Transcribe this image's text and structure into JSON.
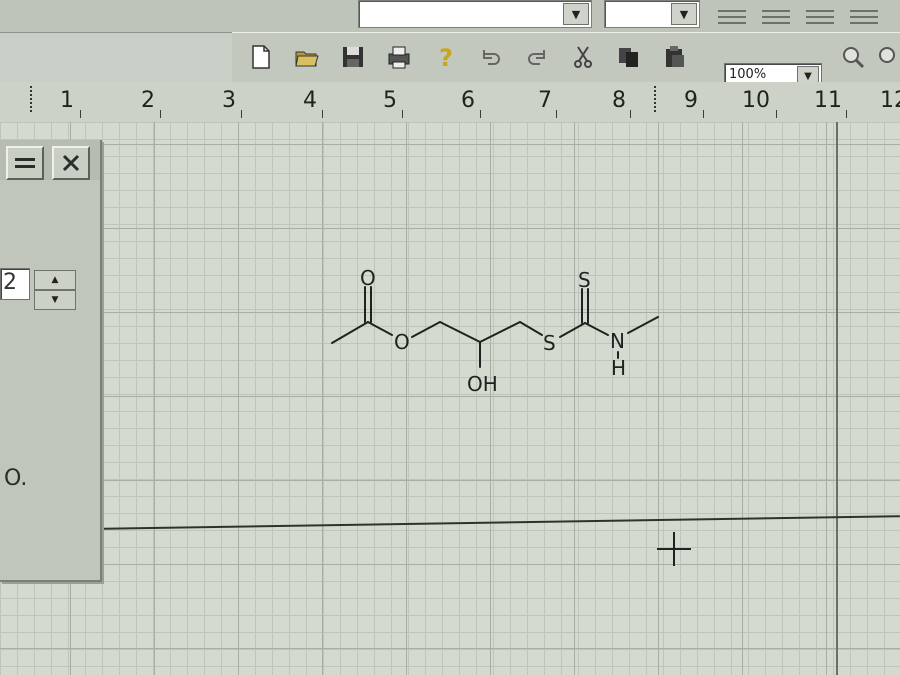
{
  "toolbar": {
    "zoom_value": "100%",
    "buttons": [
      "new-file-icon",
      "open-folder-icon",
      "save-icon",
      "print-icon",
      "help-icon",
      "undo-icon",
      "redo-icon",
      "cut-icon",
      "copy-icon",
      "paste-icon"
    ]
  },
  "ruler": {
    "labels": [
      "1",
      "2",
      "3",
      "4",
      "5",
      "6",
      "7",
      "8",
      "9",
      "10",
      "11",
      "12"
    ]
  },
  "panel": {
    "spin_value": "2",
    "text": "O."
  },
  "molecule": {
    "atoms": {
      "carbonyl_oxygen": "O",
      "ester_oxygen": "O",
      "hydroxyl": "OH",
      "thio_sulfur": "S",
      "thione_sulfur": "S",
      "nitrogen": "N",
      "amine_hydrogen": "H"
    }
  },
  "colors": {
    "canvas": "#d4dad0",
    "grid_major": "#a8aea4",
    "chrome": "#c3c8bf",
    "ink": "#1e2220"
  }
}
